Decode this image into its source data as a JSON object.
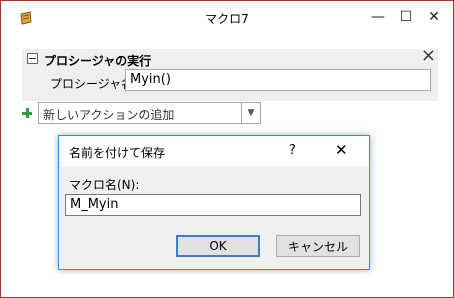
{
  "window": {
    "title": "マクロ7",
    "controls": {
      "minimize": "—",
      "maximize": "☐",
      "close": "✕"
    }
  },
  "action": {
    "title": "プロシージャの実行",
    "argument_label": "プロシージャ名",
    "argument_value": "Myin()"
  },
  "add_action": {
    "placeholder": "新しいアクションの追加",
    "dropdown_glyph": "▼"
  },
  "dialog": {
    "title": "名前を付けて保存",
    "help": "?",
    "close": "✕",
    "field_label": "マクロ名(N):",
    "field_value": "M_Myin",
    "ok_label": "OK",
    "cancel_label": "キャンセル"
  },
  "colors": {
    "window_border": "#a0372f",
    "block_bg": "#efefef",
    "dialog_border": "#3c8fd8",
    "ok_border": "#3c7fc8",
    "plus_green": "#3a9a3a"
  }
}
